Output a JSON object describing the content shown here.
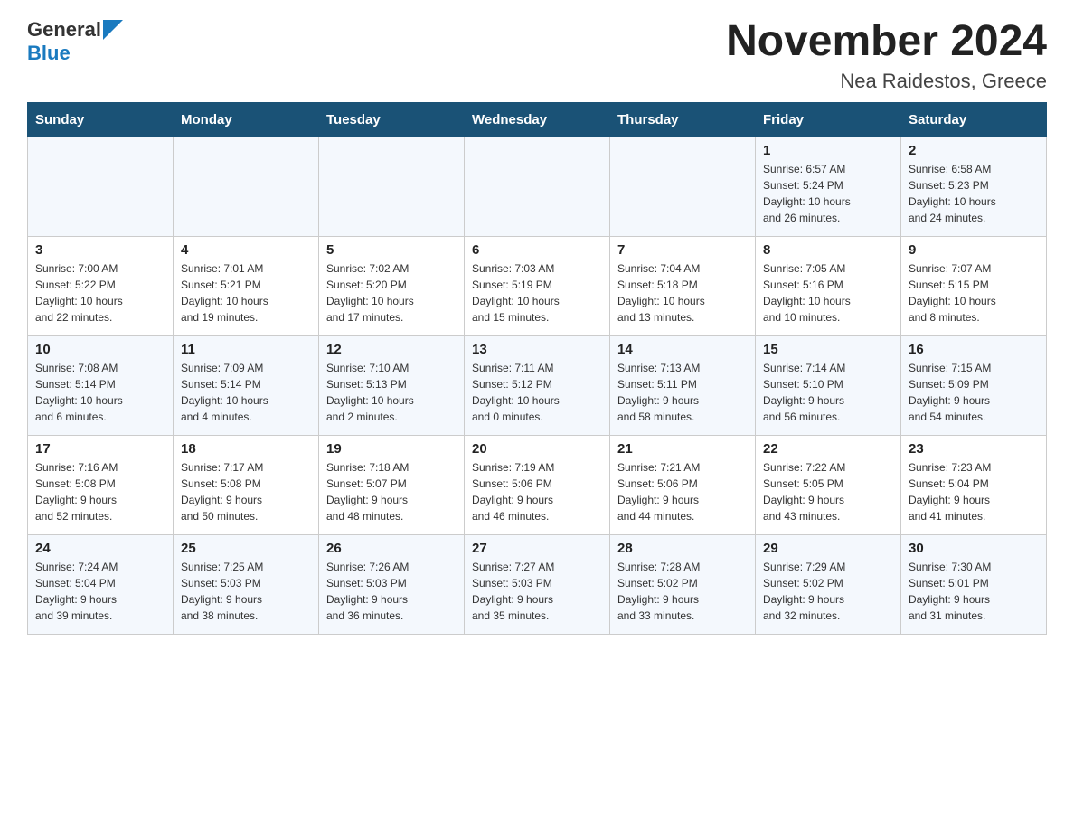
{
  "header": {
    "title": "November 2024",
    "location": "Nea Raidestos, Greece",
    "logo_general": "General",
    "logo_blue": "Blue"
  },
  "days_of_week": [
    "Sunday",
    "Monday",
    "Tuesday",
    "Wednesday",
    "Thursday",
    "Friday",
    "Saturday"
  ],
  "weeks": [
    [
      {
        "day": "",
        "info": ""
      },
      {
        "day": "",
        "info": ""
      },
      {
        "day": "",
        "info": ""
      },
      {
        "day": "",
        "info": ""
      },
      {
        "day": "",
        "info": ""
      },
      {
        "day": "1",
        "info": "Sunrise: 6:57 AM\nSunset: 5:24 PM\nDaylight: 10 hours\nand 26 minutes."
      },
      {
        "day": "2",
        "info": "Sunrise: 6:58 AM\nSunset: 5:23 PM\nDaylight: 10 hours\nand 24 minutes."
      }
    ],
    [
      {
        "day": "3",
        "info": "Sunrise: 7:00 AM\nSunset: 5:22 PM\nDaylight: 10 hours\nand 22 minutes."
      },
      {
        "day": "4",
        "info": "Sunrise: 7:01 AM\nSunset: 5:21 PM\nDaylight: 10 hours\nand 19 minutes."
      },
      {
        "day": "5",
        "info": "Sunrise: 7:02 AM\nSunset: 5:20 PM\nDaylight: 10 hours\nand 17 minutes."
      },
      {
        "day": "6",
        "info": "Sunrise: 7:03 AM\nSunset: 5:19 PM\nDaylight: 10 hours\nand 15 minutes."
      },
      {
        "day": "7",
        "info": "Sunrise: 7:04 AM\nSunset: 5:18 PM\nDaylight: 10 hours\nand 13 minutes."
      },
      {
        "day": "8",
        "info": "Sunrise: 7:05 AM\nSunset: 5:16 PM\nDaylight: 10 hours\nand 10 minutes."
      },
      {
        "day": "9",
        "info": "Sunrise: 7:07 AM\nSunset: 5:15 PM\nDaylight: 10 hours\nand 8 minutes."
      }
    ],
    [
      {
        "day": "10",
        "info": "Sunrise: 7:08 AM\nSunset: 5:14 PM\nDaylight: 10 hours\nand 6 minutes."
      },
      {
        "day": "11",
        "info": "Sunrise: 7:09 AM\nSunset: 5:14 PM\nDaylight: 10 hours\nand 4 minutes."
      },
      {
        "day": "12",
        "info": "Sunrise: 7:10 AM\nSunset: 5:13 PM\nDaylight: 10 hours\nand 2 minutes."
      },
      {
        "day": "13",
        "info": "Sunrise: 7:11 AM\nSunset: 5:12 PM\nDaylight: 10 hours\nand 0 minutes."
      },
      {
        "day": "14",
        "info": "Sunrise: 7:13 AM\nSunset: 5:11 PM\nDaylight: 9 hours\nand 58 minutes."
      },
      {
        "day": "15",
        "info": "Sunrise: 7:14 AM\nSunset: 5:10 PM\nDaylight: 9 hours\nand 56 minutes."
      },
      {
        "day": "16",
        "info": "Sunrise: 7:15 AM\nSunset: 5:09 PM\nDaylight: 9 hours\nand 54 minutes."
      }
    ],
    [
      {
        "day": "17",
        "info": "Sunrise: 7:16 AM\nSunset: 5:08 PM\nDaylight: 9 hours\nand 52 minutes."
      },
      {
        "day": "18",
        "info": "Sunrise: 7:17 AM\nSunset: 5:08 PM\nDaylight: 9 hours\nand 50 minutes."
      },
      {
        "day": "19",
        "info": "Sunrise: 7:18 AM\nSunset: 5:07 PM\nDaylight: 9 hours\nand 48 minutes."
      },
      {
        "day": "20",
        "info": "Sunrise: 7:19 AM\nSunset: 5:06 PM\nDaylight: 9 hours\nand 46 minutes."
      },
      {
        "day": "21",
        "info": "Sunrise: 7:21 AM\nSunset: 5:06 PM\nDaylight: 9 hours\nand 44 minutes."
      },
      {
        "day": "22",
        "info": "Sunrise: 7:22 AM\nSunset: 5:05 PM\nDaylight: 9 hours\nand 43 minutes."
      },
      {
        "day": "23",
        "info": "Sunrise: 7:23 AM\nSunset: 5:04 PM\nDaylight: 9 hours\nand 41 minutes."
      }
    ],
    [
      {
        "day": "24",
        "info": "Sunrise: 7:24 AM\nSunset: 5:04 PM\nDaylight: 9 hours\nand 39 minutes."
      },
      {
        "day": "25",
        "info": "Sunrise: 7:25 AM\nSunset: 5:03 PM\nDaylight: 9 hours\nand 38 minutes."
      },
      {
        "day": "26",
        "info": "Sunrise: 7:26 AM\nSunset: 5:03 PM\nDaylight: 9 hours\nand 36 minutes."
      },
      {
        "day": "27",
        "info": "Sunrise: 7:27 AM\nSunset: 5:03 PM\nDaylight: 9 hours\nand 35 minutes."
      },
      {
        "day": "28",
        "info": "Sunrise: 7:28 AM\nSunset: 5:02 PM\nDaylight: 9 hours\nand 33 minutes."
      },
      {
        "day": "29",
        "info": "Sunrise: 7:29 AM\nSunset: 5:02 PM\nDaylight: 9 hours\nand 32 minutes."
      },
      {
        "day": "30",
        "info": "Sunrise: 7:30 AM\nSunset: 5:01 PM\nDaylight: 9 hours\nand 31 minutes."
      }
    ]
  ]
}
